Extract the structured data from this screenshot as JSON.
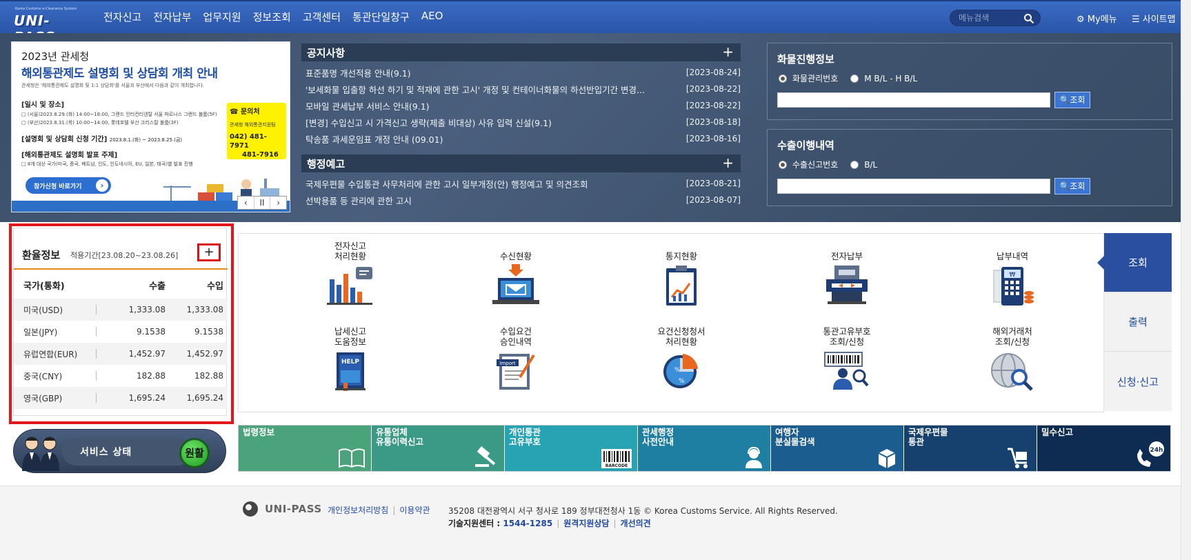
{
  "header": {
    "logo_small": "Korea Customs e-Clearance System",
    "logo_text": "UNI-PASS",
    "menu": [
      "전자신고",
      "전자납부",
      "업무지원",
      "정보조회",
      "고객센터",
      "통관단일창구",
      "AEO"
    ],
    "search_placeholder": "메뉴검색",
    "my_menu": "My메뉴",
    "sitemap": "사이트맵"
  },
  "banner": {
    "year": "2023년 관세청",
    "title_highlight": "해외통관제도 설명회 및 상담회",
    "title_rest": " 개최 안내",
    "desc": "관세청은 '해외통관제도 설명회 및 1:1 상담회'를 서울과 부산에서 다음과 같이 개최합니다.",
    "sec1_title": "[일시 및 장소]",
    "sec1_line1": "□ (서울)2023.8.29.(화) 14:00~18:00, 그랜드 인터컨티넨탈 서울 파르나스 그랜드 볼룸(5F)",
    "sec1_line2": "□ (부산)2023.8.31.(목) 10:00~14:00, 롯데호텔 부산 크리스탈 볼룸(3F)",
    "sec2_title": "[설명회 및 상담회 신청 기간]",
    "sec2_period": "2023.8.1.(화) ~ 2023.8.25.(금)",
    "sec3_title": "[해외통관제도 설명회 발표 주제]",
    "sec3_line": "□ 8개 대상 국가(미국, 중국, 베트남, 인도, 인도네시아, EU, 일본, 태국)별 발표 진행",
    "contact_title": "문의처",
    "contact_org": "관세청 해외통관지원팀",
    "contact_phone1": "042) 481-7971",
    "contact_phone2": "481-7916",
    "apply_btn": "참가신청 바로가기",
    "pager_prev": "‹",
    "pager_pause": "II",
    "pager_next": "›"
  },
  "notices": {
    "title": "공지사항",
    "plus": "+",
    "items": [
      {
        "title": "표준품명 개선적용 안내(9.1)",
        "date": "[2023-08-24]"
      },
      {
        "title": "'보세화물 입출항 하선 하기 및 적재에 관한 고시' 개정 및 컨테이너화물의 하선반입기간 변경...",
        "date": "[2023-08-22]"
      },
      {
        "title": "모바일 관세납부 서비스 안내(9.1)",
        "date": "[2023-08-22]"
      },
      {
        "title": "[변경] 수입신고 시 가격신고 생략(제출 비대상) 사유 입력 신설(9.1)",
        "date": "[2023-08-18]"
      },
      {
        "title": "탁송품 과세운임표 개정 안내 (09.01)",
        "date": "[2023-08-16]"
      }
    ]
  },
  "admin_notices": {
    "title": "행정예고",
    "plus": "+",
    "items": [
      {
        "title": "국제우편물 수입통관 사무처리에 관한 고시 일부개정(안) 행정예고 및 의견조회",
        "date": "[2023-08-21]"
      },
      {
        "title": "선박용품 등 관리에 관한 고시",
        "date": "[2023-08-07]"
      }
    ]
  },
  "cargo": {
    "title": "화물진행정보",
    "radio1": "화물관리번호",
    "radio2": "M B/L - H B/L",
    "button": "조회"
  },
  "export": {
    "title": "수출이행내역",
    "radio1": "수출신고번호",
    "radio2": "B/L",
    "button": "조회"
  },
  "exchange": {
    "title": "환율정보",
    "period": "적용기간[23.08.20~23.08.26]",
    "plus": "+",
    "headers": [
      "국가(통화)",
      "수출",
      "수입"
    ],
    "rows": [
      {
        "country": "미국(USD)",
        "export": "1,333.08",
        "import": "1,333.08"
      },
      {
        "country": "일본(JPY)",
        "export": "9.1538",
        "import": "9.1538"
      },
      {
        "country": "유럽연합(EUR)",
        "export": "1,452.97",
        "import": "1,452.97"
      },
      {
        "country": "중국(CNY)",
        "export": "182.88",
        "import": "182.88"
      },
      {
        "country": "영국(GBP)",
        "export": "1,695.24",
        "import": "1,695.24"
      }
    ]
  },
  "service": {
    "label": "서비스 상태",
    "status": "원활"
  },
  "grid": {
    "row1": [
      {
        "line1": "전자신고",
        "line2": "처리현황",
        "icon": "bar-chart-icon"
      },
      {
        "line1": "",
        "line2": "수신현황",
        "icon": "laptop-mail-icon"
      },
      {
        "line1": "",
        "line2": "통지현황",
        "icon": "clipboard-chart-icon"
      },
      {
        "line1": "",
        "line2": "전자납부",
        "icon": "atm-icon"
      },
      {
        "line1": "",
        "line2": "납부내역",
        "icon": "calculator-icon"
      }
    ],
    "row2": [
      {
        "line1": "납세신고",
        "line2": "도움정보",
        "icon": "help-book-icon"
      },
      {
        "line1": "수입요건",
        "line2": "승인내역",
        "icon": "import-doc-icon"
      },
      {
        "line1": "요건신청청서",
        "line2": "처리현황",
        "icon": "pie-chart-icon"
      },
      {
        "line1": "통관고유부호",
        "line2": "조회/신청",
        "icon": "barcode-person-icon"
      },
      {
        "line1": "해외거래처",
        "line2": "조회/신청",
        "icon": "globe-search-icon"
      }
    ]
  },
  "sidetabs": [
    "조회",
    "출력",
    "신청·신고"
  ],
  "tiles": [
    {
      "line1": "법령정보",
      "line2": "",
      "color": "#4aa37a",
      "icon": "book-icon"
    },
    {
      "line1": "유통업체",
      "line2": "유통이력신고",
      "color": "#3a9a86",
      "icon": "gavel-icon"
    },
    {
      "line1": "개인통관",
      "line2": "고유부호",
      "color": "#28a3b3",
      "icon": "barcode-icon",
      "icon_label": "BARCODE"
    },
    {
      "line1": "관세행정",
      "line2": "사전안내",
      "color": "#1f7fa3",
      "icon": "operator-icon"
    },
    {
      "line1": "여행자",
      "line2": "분실물검색",
      "color": "#1a5d8e",
      "icon": "box-icon"
    },
    {
      "line1": "국제우편물",
      "line2": "통관",
      "color": "#16406e",
      "icon": "cart-icon"
    },
    {
      "line1": "밀수신고",
      "line2": "",
      "color": "#0e2c52",
      "icon": "phone-24h-icon",
      "icon_label": "24h"
    }
  ],
  "footer": {
    "logo": "UNI-PASS",
    "privacy": "개인정보처리방침",
    "terms": "이용약관",
    "address": "35208 대전광역시 서구 청사로 189 정부대전청사 1동 © Korea Customs Service. All Rights Reserved.",
    "support_label": "기술지원센터 : ",
    "support_number": "1544-1285",
    "remote": "원격지원상담",
    "feedback": "개선의견"
  }
}
